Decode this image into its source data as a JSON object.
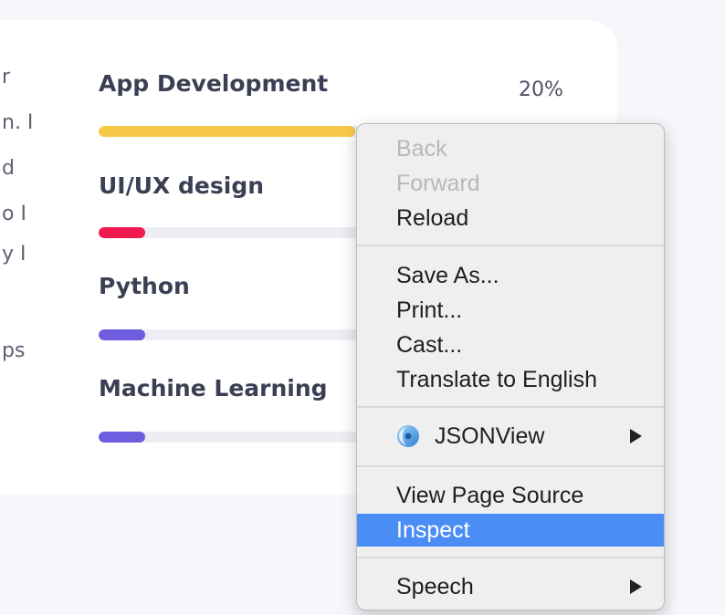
{
  "left_snippet": [
    "r",
    "n. I",
    "d",
    "o I",
    "y I",
    "",
    "ps"
  ],
  "skills": [
    {
      "title": "App Development",
      "percent": "20%",
      "progress": 0.52,
      "color": "#f7c948"
    },
    {
      "title": "UI/UX design",
      "percent": "",
      "progress": 0.095,
      "color": "#f0184e"
    },
    {
      "title": "Python",
      "percent": "",
      "progress": 0.095,
      "color": "#6f5de0"
    },
    {
      "title": "Machine Learning",
      "percent": "",
      "progress": 0.095,
      "color": "#6f5de0"
    }
  ],
  "context_menu": {
    "back": "Back",
    "forward": "Forward",
    "reload": "Reload",
    "save_as": "Save As...",
    "print": "Print...",
    "cast": "Cast...",
    "translate": "Translate to English",
    "jsonview": "JSONView",
    "view_source": "View Page Source",
    "inspect": "Inspect",
    "speech": "Speech",
    "highlight_color": "#4a8ef5",
    "jsonview_icon": "jsonview-logo-icon",
    "submenu_icon": "submenu-arrow-icon"
  }
}
